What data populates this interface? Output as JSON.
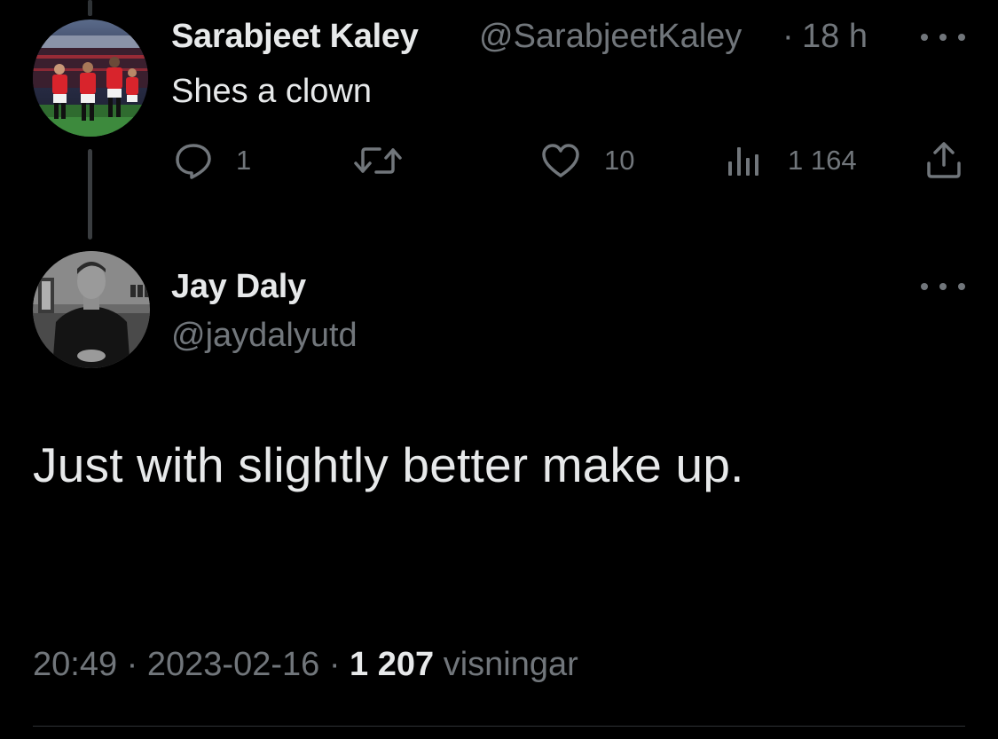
{
  "reply_tweet": {
    "author_name": "Sarabjeet Kaley",
    "author_handle": "@SarabjeetKaley",
    "separator": "·",
    "time": "18 h",
    "text": "Shes a clown",
    "actions": {
      "replies": "1",
      "retweets": "",
      "likes": "10",
      "views": "1 164"
    },
    "avatar_icon": "football-team-photo-avatar"
  },
  "main_tweet": {
    "author_name": "Jay Daly",
    "author_handle": "@jaydalyutd",
    "text": "Just with slightly better make up.",
    "time": "20:49",
    "separator": "·",
    "date": "2023-02-16",
    "views_count": "1 207",
    "views_label": "visningar",
    "avatar_icon": "person-portrait-avatar"
  },
  "colors": {
    "background": "#000000",
    "primary_text": "#e7e9ea",
    "secondary_text": "#71767b",
    "thread_line": "#3a3d40"
  },
  "icons": {
    "reply": "reply-bubble-icon",
    "retweet": "retweet-icon",
    "like": "heart-icon",
    "views": "bar-chart-icon",
    "share": "share-upload-icon",
    "more": "more-dots-icon"
  }
}
